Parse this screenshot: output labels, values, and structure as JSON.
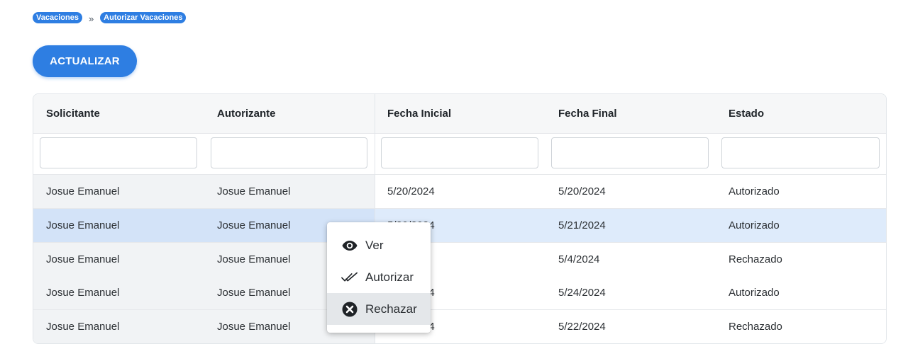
{
  "breadcrumb": {
    "items": [
      "Vacaciones",
      "Autorizar Vacaciones"
    ],
    "separator": "»"
  },
  "toolbar": {
    "refresh_label": "ACTUALIZAR"
  },
  "grid": {
    "columns": [
      "Solicitante",
      "Autorizante",
      "Fecha Inicial",
      "Fecha Final",
      "Estado"
    ],
    "filters": [
      "",
      "",
      "",
      "",
      ""
    ],
    "rows": [
      {
        "solicitante": "Josue Emanuel",
        "autorizante": "Josue Emanuel",
        "fecha_inicial": "5/20/2024",
        "fecha_final": "5/20/2024",
        "estado": "Autorizado"
      },
      {
        "solicitante": "Josue Emanuel",
        "autorizante": "Josue Emanuel",
        "fecha_inicial": "5/20/2024",
        "fecha_final": "5/21/2024",
        "estado": "Autorizado"
      },
      {
        "solicitante": "Josue Emanuel",
        "autorizante": "Josue Emanuel",
        "fecha_inicial": "5/4/2024",
        "fecha_final": "5/4/2024",
        "estado": "Rechazado"
      },
      {
        "solicitante": "Josue Emanuel",
        "autorizante": "Josue Emanuel",
        "fecha_inicial": "5/24/2024",
        "fecha_final": "5/24/2024",
        "estado": "Autorizado"
      },
      {
        "solicitante": "Josue Emanuel",
        "autorizante": "Josue Emanuel",
        "fecha_inicial": "5/22/2024",
        "fecha_final": "5/22/2024",
        "estado": "Rechazado"
      }
    ]
  },
  "context_menu": {
    "items": [
      {
        "label": "Ver",
        "icon": "eye-icon"
      },
      {
        "label": "Autorizar",
        "icon": "double-check-icon"
      },
      {
        "label": "Rechazar",
        "icon": "circle-x-icon"
      }
    ]
  },
  "colors": {
    "accent": "#2e7ee2",
    "selected_row": "#deebfb"
  }
}
